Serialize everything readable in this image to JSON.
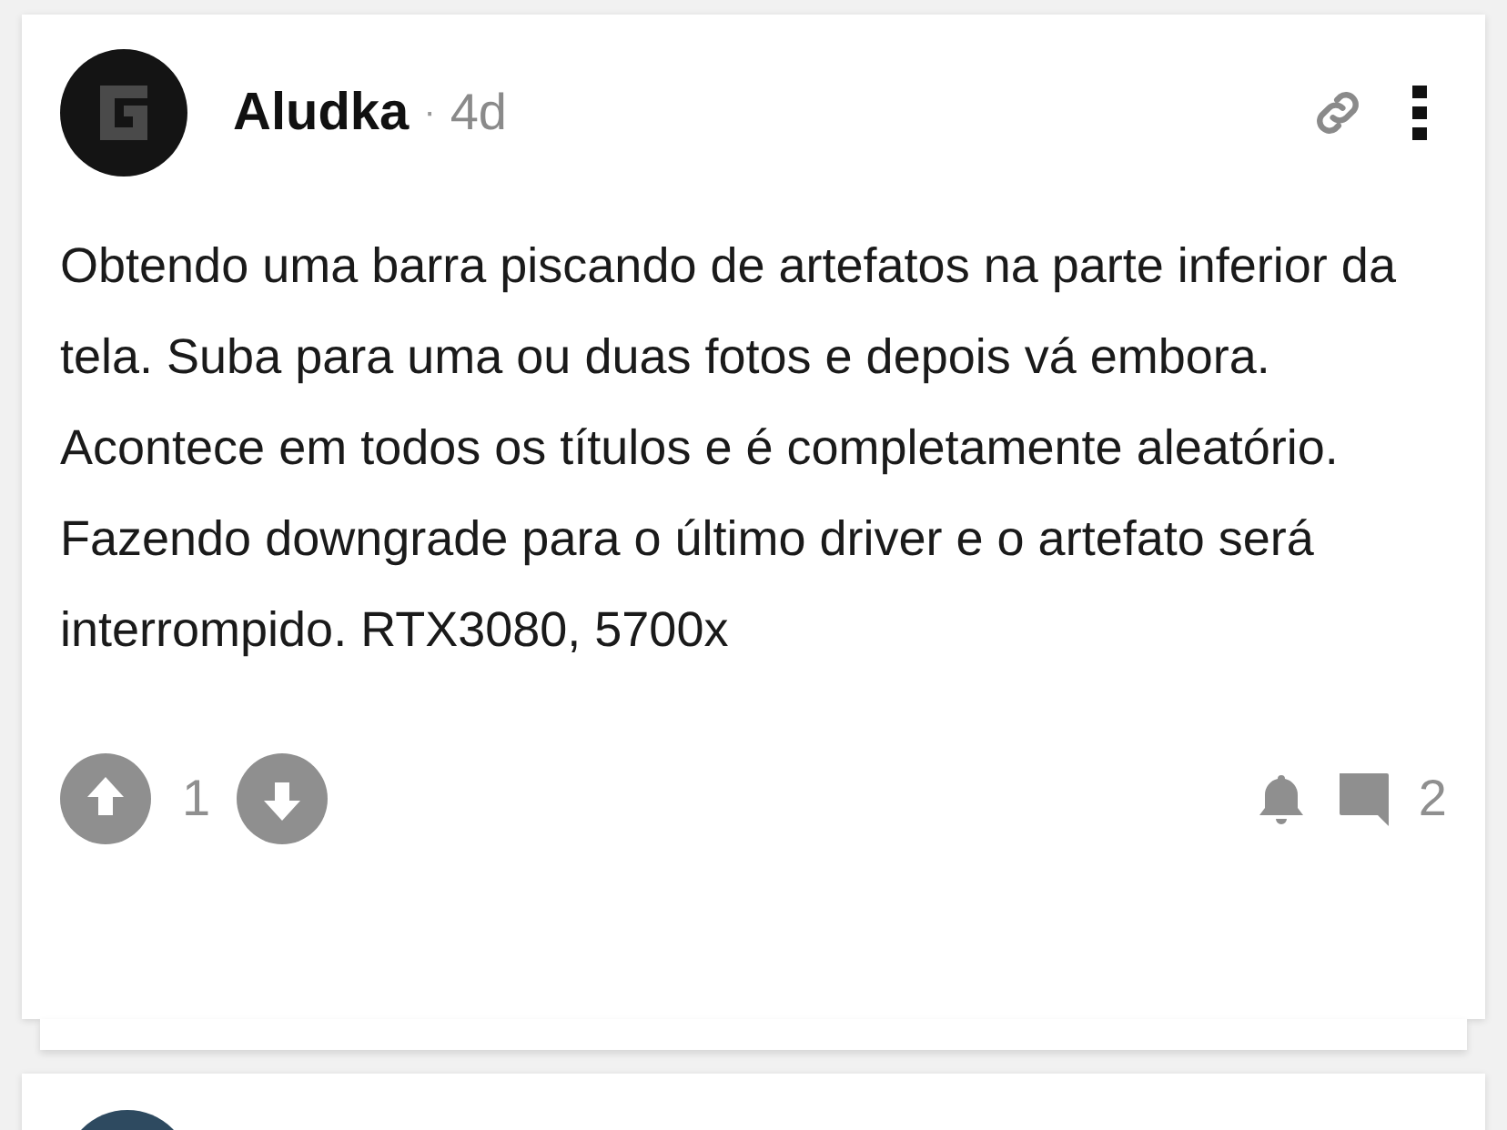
{
  "post": {
    "author": "Aludka",
    "separator": "·",
    "age": "4d",
    "body": "Obtendo uma barra piscando de artefatos na parte inferior da tela. Suba para uma ou duas fotos e depois vá embora. Acontece em todos os títulos e é completamente aleatório. Fazendo downgrade para o último driver e o artefato será interrompido. RTX3080, 5700x",
    "votes": "1",
    "comments": "2"
  }
}
